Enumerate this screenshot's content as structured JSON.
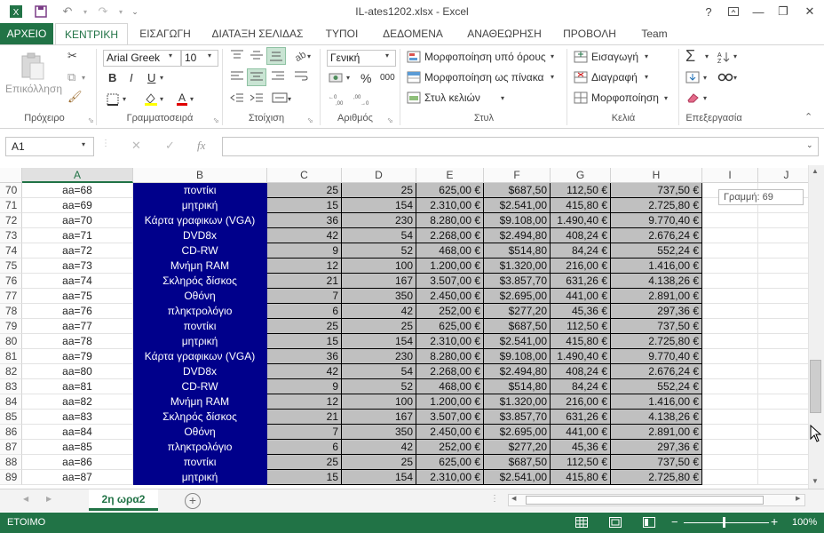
{
  "app": {
    "title": "IL-ates1202.xlsx - Excel",
    "help_icon": "?",
    "window_buttons": [
      "ribbon-display-icon",
      "minimize-icon",
      "restore-icon",
      "close-icon"
    ]
  },
  "tabs": [
    {
      "label": "ΑΡΧΕΙΟ",
      "kind": "file"
    },
    {
      "label": "ΚΕΝΤΡΙΚΗ",
      "kind": "active"
    },
    {
      "label": "ΕΙΣΑΓΩΓΗ"
    },
    {
      "label": "ΔΙΑΤΑΞΗ ΣΕΛΙΔΑΣ"
    },
    {
      "label": "ΤΥΠΟΙ"
    },
    {
      "label": "ΔΕΔΟΜΕΝΑ"
    },
    {
      "label": "ΑΝΑΘΕΩΡΗΣΗ"
    },
    {
      "label": "ΠΡΟΒΟΛΗ"
    },
    {
      "label": "Team"
    }
  ],
  "ribbon": {
    "clipboard": {
      "paste_label": "Επικόλληση",
      "group_label": "Πρόχειρο"
    },
    "font": {
      "name": "Arial Greek",
      "size": "10",
      "group_label": "Γραμματοσειρά",
      "bold": "B",
      "italic": "I",
      "underline": "U"
    },
    "alignment": {
      "group_label": "Στοίχιση"
    },
    "number": {
      "format": "Γενική",
      "group_label": "Αριθμός",
      "percent": "%",
      "thousands": "000"
    },
    "styles": {
      "conditional": "Μορφοποίηση υπό όρους",
      "as_table": "Μορφοποίηση ως πίνακα",
      "cell_styles": "Στυλ κελιών",
      "group_label": "Στυλ"
    },
    "cells": {
      "insert": "Εισαγωγή",
      "delete": "Διαγραφή",
      "format": "Μορφοποίηση",
      "group_label": "Κελιά"
    },
    "editing": {
      "group_label": "Επεξεργασία"
    }
  },
  "formula_bar": {
    "name_box": "A1",
    "fx": "fx",
    "value": ""
  },
  "grid": {
    "columns": [
      "A",
      "B",
      "C",
      "D",
      "E",
      "F",
      "G",
      "H",
      "I",
      "J"
    ],
    "selected_column": "A",
    "rows": [
      {
        "n": "70",
        "a": "aa=68",
        "b": "ποντίκι",
        "c": "25",
        "d": "25",
        "e": "625,00 €",
        "f": "$687,50",
        "g": "112,50 €",
        "h": "737,50 €"
      },
      {
        "n": "71",
        "a": "aa=69",
        "b": "μητρική",
        "c": "15",
        "d": "154",
        "e": "2.310,00 €",
        "f": "$2.541,00",
        "g": "415,80 €",
        "h": "2.725,80 €"
      },
      {
        "n": "72",
        "a": "aa=70",
        "b": "Κάρτα γραφικων (VGA)",
        "c": "36",
        "d": "230",
        "e": "8.280,00 €",
        "f": "$9.108,00",
        "g": "1.490,40 €",
        "h": "9.770,40 €"
      },
      {
        "n": "73",
        "a": "aa=71",
        "b": "DVD8x",
        "c": "42",
        "d": "54",
        "e": "2.268,00 €",
        "f": "$2.494,80",
        "g": "408,24 €",
        "h": "2.676,24 €"
      },
      {
        "n": "74",
        "a": "aa=72",
        "b": "CD-RW",
        "c": "9",
        "d": "52",
        "e": "468,00 €",
        "f": "$514,80",
        "g": "84,24 €",
        "h": "552,24 €"
      },
      {
        "n": "75",
        "a": "aa=73",
        "b": "Μνήμη RAM",
        "c": "12",
        "d": "100",
        "e": "1.200,00 €",
        "f": "$1.320,00",
        "g": "216,00 €",
        "h": "1.416,00 €"
      },
      {
        "n": "76",
        "a": "aa=74",
        "b": "Σκληρός δίσκος",
        "c": "21",
        "d": "167",
        "e": "3.507,00 €",
        "f": "$3.857,70",
        "g": "631,26 €",
        "h": "4.138,26 €"
      },
      {
        "n": "77",
        "a": "aa=75",
        "b": "Οθόνη",
        "c": "7",
        "d": "350",
        "e": "2.450,00 €",
        "f": "$2.695,00",
        "g": "441,00 €",
        "h": "2.891,00 €"
      },
      {
        "n": "78",
        "a": "aa=76",
        "b": "πληκτρολόγιο",
        "c": "6",
        "d": "42",
        "e": "252,00 €",
        "f": "$277,20",
        "g": "45,36 €",
        "h": "297,36 €"
      },
      {
        "n": "79",
        "a": "aa=77",
        "b": "ποντίκι",
        "c": "25",
        "d": "25",
        "e": "625,00 €",
        "f": "$687,50",
        "g": "112,50 €",
        "h": "737,50 €"
      },
      {
        "n": "80",
        "a": "aa=78",
        "b": "μητρική",
        "c": "15",
        "d": "154",
        "e": "2.310,00 €",
        "f": "$2.541,00",
        "g": "415,80 €",
        "h": "2.725,80 €"
      },
      {
        "n": "81",
        "a": "aa=79",
        "b": "Κάρτα γραφικων (VGA)",
        "c": "36",
        "d": "230",
        "e": "8.280,00 €",
        "f": "$9.108,00",
        "g": "1.490,40 €",
        "h": "9.770,40 €"
      },
      {
        "n": "82",
        "a": "aa=80",
        "b": "DVD8x",
        "c": "42",
        "d": "54",
        "e": "2.268,00 €",
        "f": "$2.494,80",
        "g": "408,24 €",
        "h": "2.676,24 €"
      },
      {
        "n": "83",
        "a": "aa=81",
        "b": "CD-RW",
        "c": "9",
        "d": "52",
        "e": "468,00 €",
        "f": "$514,80",
        "g": "84,24 €",
        "h": "552,24 €"
      },
      {
        "n": "84",
        "a": "aa=82",
        "b": "Μνήμη RAM",
        "c": "12",
        "d": "100",
        "e": "1.200,00 €",
        "f": "$1.320,00",
        "g": "216,00 €",
        "h": "1.416,00 €"
      },
      {
        "n": "85",
        "a": "aa=83",
        "b": "Σκληρός δίσκος",
        "c": "21",
        "d": "167",
        "e": "3.507,00 €",
        "f": "$3.857,70",
        "g": "631,26 €",
        "h": "4.138,26 €"
      },
      {
        "n": "86",
        "a": "aa=84",
        "b": "Οθόνη",
        "c": "7",
        "d": "350",
        "e": "2.450,00 €",
        "f": "$2.695,00",
        "g": "441,00 €",
        "h": "2.891,00 €"
      },
      {
        "n": "87",
        "a": "aa=85",
        "b": "πληκτρολόγιο",
        "c": "6",
        "d": "42",
        "e": "252,00 €",
        "f": "$277,20",
        "g": "45,36 €",
        "h": "297,36 €"
      },
      {
        "n": "88",
        "a": "aa=86",
        "b": "ποντίκι",
        "c": "25",
        "d": "25",
        "e": "625,00 €",
        "f": "$687,50",
        "g": "112,50 €",
        "h": "737,50 €"
      },
      {
        "n": "89",
        "a": "aa=87",
        "b": "μητρική",
        "c": "15",
        "d": "154",
        "e": "2.310,00 €",
        "f": "$2.541,00",
        "g": "415,80 €",
        "h": "2.725,80 €"
      }
    ]
  },
  "scroll_tooltip": "Γραμμή: 69",
  "sheet": {
    "active_tab": "2η ωρα2",
    "add_icon": "+"
  },
  "status": {
    "mode": "ΕΤΟΙΜΟ",
    "zoom": "100%"
  },
  "colors": {
    "accent": "#217346",
    "column_b_fill": "#00008b",
    "number_fill": "#c0c0c0"
  }
}
